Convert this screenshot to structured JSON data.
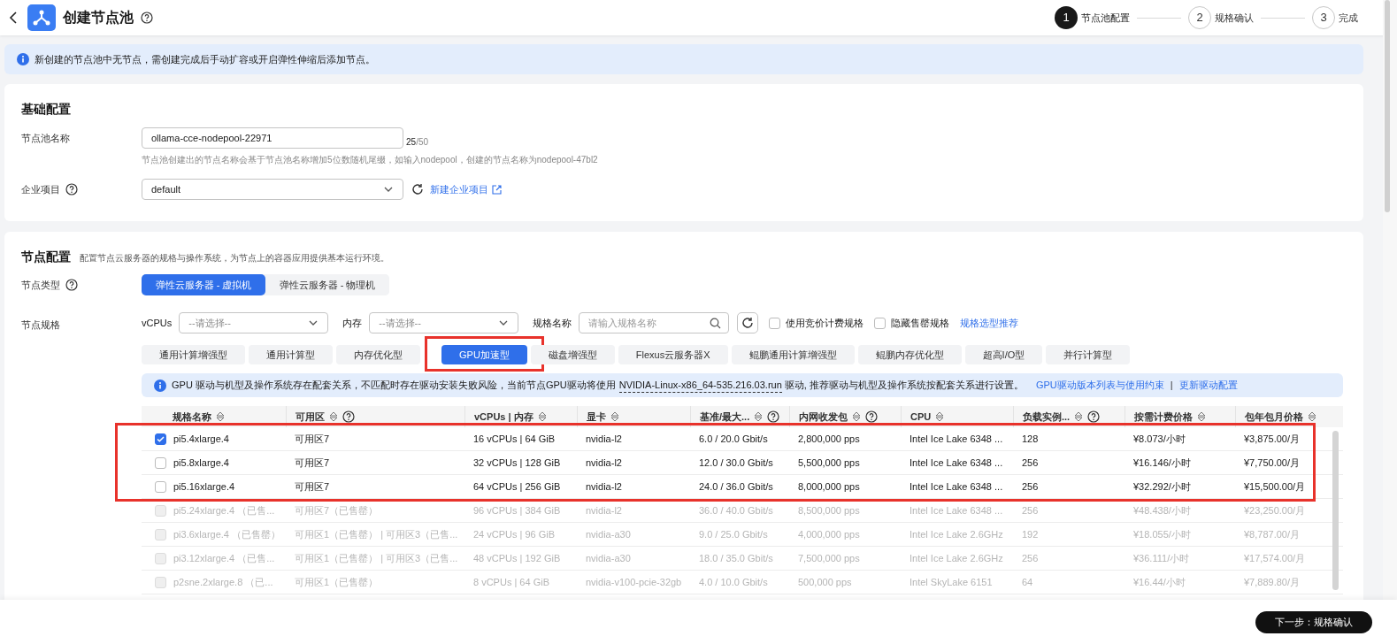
{
  "header": {
    "title": "创建节点池",
    "steps": [
      {
        "number": "1",
        "label": "节点池配置",
        "selected": true
      },
      {
        "number": "2",
        "label": "规格确认",
        "selected": false
      },
      {
        "number": "3",
        "label": "完成",
        "selected": false
      }
    ]
  },
  "notice": "新创建的节点池中无节点，需创建完成后手动扩容或开启弹性伸缩后添加节点。",
  "basic": {
    "title": "基础配置",
    "name_label": "节点池名称",
    "name_value": "ollama-cce-nodepool-22971",
    "name_count": "25",
    "name_max": "/50",
    "name_hint": "节点池创建出的节点名称会基于节点池名称增加5位数随机尾缀，如输入nodepool，创建的节点名称为nodepool-47bl2",
    "project_label": "企业项目",
    "project_value": "default",
    "project_link": "新建企业项目"
  },
  "node": {
    "title": "节点配置",
    "description": "配置节点云服务器的规格与操作系统，为节点上的容器应用提供基本运行环境。",
    "type_label": "节点类型",
    "types": [
      {
        "label": "弹性云服务器 - 虚拟机",
        "selected": true
      },
      {
        "label": "弹性云服务器 - 物理机",
        "selected": false
      }
    ],
    "spec_label": "节点规格",
    "filters": {
      "vcpus_label": "vCPUs",
      "vcpus_placeholder": "--请选择--",
      "memory_label": "内存",
      "memory_placeholder": "--请选择--",
      "name_label": "规格名称",
      "name_placeholder": "请输入规格名称",
      "options": [
        {
          "label": "使用竞价计费规格",
          "checked": false
        },
        {
          "label": "隐藏售罄规格",
          "checked": false
        }
      ],
      "link": "规格选型推荐"
    },
    "spec_tabs": [
      {
        "label": "通用计算增强型",
        "selected": false,
        "highlighted": false
      },
      {
        "label": "通用计算型",
        "selected": false,
        "highlighted": false
      },
      {
        "label": "内存优化型",
        "selected": false,
        "highlighted": false
      },
      {
        "label": "GPU加速型",
        "selected": true,
        "highlighted": true
      },
      {
        "label": "磁盘增强型",
        "selected": false,
        "highlighted": false
      },
      {
        "label": "Flexus云服务器X",
        "selected": false,
        "highlighted": false
      },
      {
        "label": "鲲鹏通用计算增强型",
        "selected": false,
        "highlighted": false
      },
      {
        "label": "鲲鹏内存优化型",
        "selected": false,
        "highlighted": false
      },
      {
        "label": "超高I/O型",
        "selected": false,
        "highlighted": false
      },
      {
        "label": "并行计算型",
        "selected": false,
        "highlighted": false
      }
    ],
    "gpu_notice": {
      "before": "GPU 驱动与机型及操作系统存在配套关系，不匹配时存在驱动安装失败风险，当前节点GPU驱动将使用",
      "driver": "NVIDIA-Linux-x86_64-535.216.03.run",
      "after": "驱动, 推荐驱动与机型及操作系统按配套关系进行设置。",
      "links": [
        "GPU驱动版本列表与使用约束",
        "更新驱动配置"
      ],
      "separator": "|"
    },
    "table": {
      "columns": [
        {
          "label": "规格名称",
          "help": false
        },
        {
          "label": "可用区",
          "help": true
        },
        {
          "label": "vCPUs | 内存",
          "help": false
        },
        {
          "label": "显卡",
          "help": false
        },
        {
          "label": "基准/最大...",
          "help": true
        },
        {
          "label": "内网收发包",
          "help": true
        },
        {
          "label": "CPU",
          "help": false
        },
        {
          "label": "负载实例...",
          "help": true
        },
        {
          "label": "按需计费价格",
          "help": false
        },
        {
          "label": "包年包月价格",
          "help": false
        }
      ],
      "rows": [
        {
          "checked": true,
          "disabled": false,
          "highlighted": true,
          "cells": [
            "pi5.4xlarge.4",
            "可用区7",
            "16 vCPUs | 64 GiB",
            "nvidia-l2",
            "6.0 / 20.0 Gbit/s",
            "2,800,000 pps",
            "Intel Ice Lake 6348 ...",
            "128",
            "¥8.073/小时",
            "¥3,875.00/月"
          ]
        },
        {
          "checked": false,
          "disabled": false,
          "highlighted": true,
          "cells": [
            "pi5.8xlarge.4",
            "可用区7",
            "32 vCPUs | 128 GiB",
            "nvidia-l2",
            "12.0 / 30.0 Gbit/s",
            "5,500,000 pps",
            "Intel Ice Lake 6348 ...",
            "256",
            "¥16.146/小时",
            "¥7,750.00/月"
          ]
        },
        {
          "checked": false,
          "disabled": false,
          "highlighted": true,
          "cells": [
            "pi5.16xlarge.4",
            "可用区7",
            "64 vCPUs | 256 GiB",
            "nvidia-l2",
            "24.0 / 36.0 Gbit/s",
            "8,000,000 pps",
            "Intel Ice Lake 6348 ...",
            "256",
            "¥32.292/小时",
            "¥15,500.00/月"
          ]
        },
        {
          "checked": false,
          "disabled": true,
          "highlighted": false,
          "cells": [
            "pi5.24xlarge.4 （已售...",
            "可用区7（已售罄）",
            "96 vCPUs | 384 GiB",
            "nvidia-l2",
            "36.0 / 40.0 Gbit/s",
            "8,500,000 pps",
            "Intel Ice Lake 6348 ...",
            "256",
            "¥48.438/小时",
            "¥23,250.00/月"
          ]
        },
        {
          "checked": false,
          "disabled": true,
          "highlighted": false,
          "cells": [
            "pi3.6xlarge.4 （已售罄）",
            "可用区1（已售罄） | 可用区3（已售...",
            "24 vCPUs | 96 GiB",
            "nvidia-a30",
            "9.0 / 25.0 Gbit/s",
            "4,000,000 pps",
            "Intel Ice Lake 2.6GHz",
            "192",
            "¥18.055/小时",
            "¥8,787.00/月"
          ]
        },
        {
          "checked": false,
          "disabled": true,
          "highlighted": false,
          "cells": [
            "pi3.12xlarge.4 （已售...",
            "可用区1（已售罄） | 可用区3（已售...",
            "48 vCPUs | 192 GiB",
            "nvidia-a30",
            "18.0 / 35.0 Gbit/s",
            "7,500,000 pps",
            "Intel Ice Lake 2.6GHz",
            "256",
            "¥36.111/小时",
            "¥17,574.00/月"
          ]
        },
        {
          "checked": false,
          "disabled": true,
          "highlighted": false,
          "cells": [
            "p2sne.2xlarge.8 （已...",
            "可用区1（已售罄）",
            "8 vCPUs | 64 GiB",
            "nvidia-v100-pcie-32gb",
            "4.0 / 10.0 Gbit/s",
            "500,000 pps",
            "Intel SkyLake 6151",
            "64",
            "¥16.44/小时",
            "¥7,889.80/月"
          ]
        }
      ]
    }
  },
  "footer": {
    "next_button": "下一步：规格确认"
  }
}
